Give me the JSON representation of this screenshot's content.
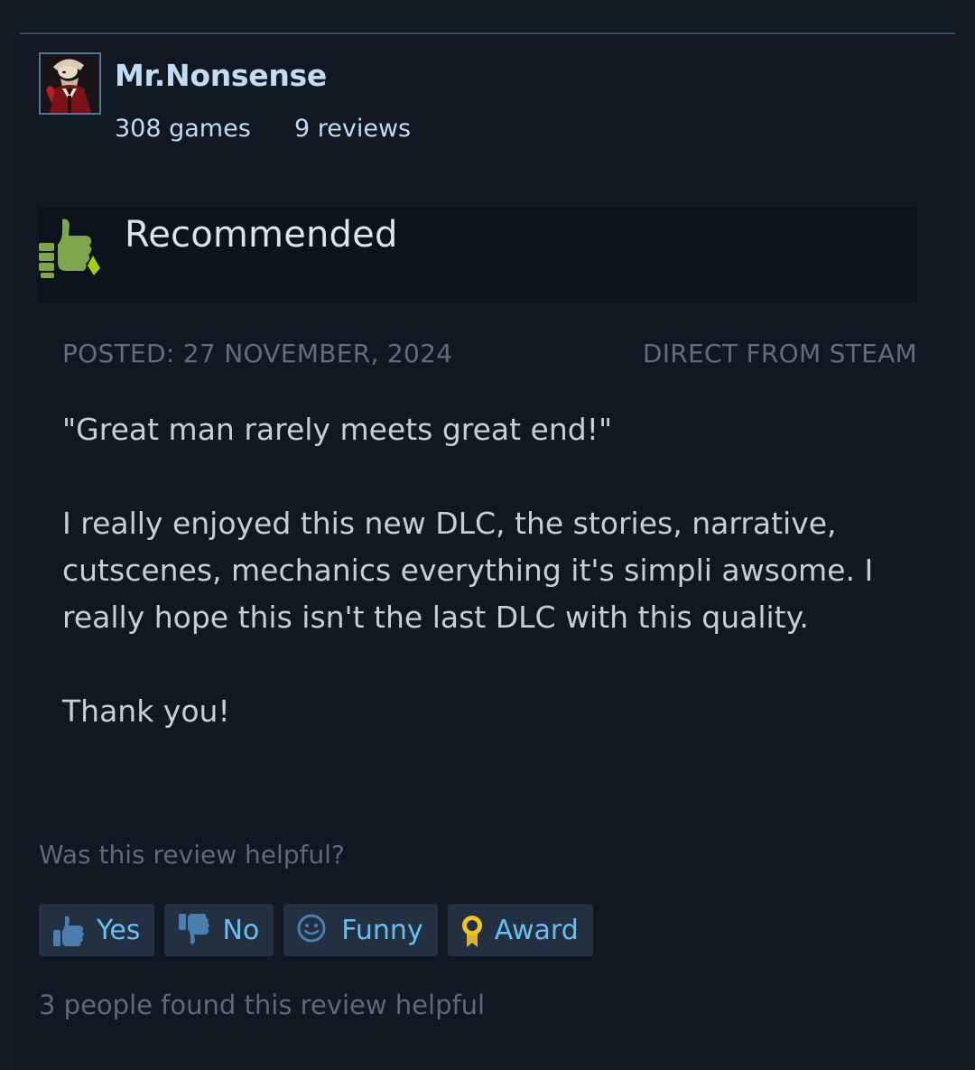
{
  "reviewer": {
    "name": "Mr.Nonsense",
    "games": "308 games",
    "reviews": "9 reviews"
  },
  "verdict": {
    "label": "Recommended",
    "icon": "thumbs-up-icon",
    "color": "#a4d007"
  },
  "meta": {
    "posted": "POSTED: 27 NOVEMBER, 2024",
    "source": "DIRECT FROM STEAM"
  },
  "review": {
    "paragraphs": [
      "\"Great man rarely meets great end!\"",
      "I really enjoyed this new DLC, the stories, narrative, cutscenes, mechanics everything it's simpli awsome. I really hope this isn't the last DLC with this quality.",
      "Thank you!"
    ]
  },
  "helpful": {
    "prompt": "Was this review helpful?",
    "buttons": [
      {
        "label": "Yes",
        "icon": "thumbs-up-icon"
      },
      {
        "label": "No",
        "icon": "thumbs-down-icon"
      },
      {
        "label": "Funny",
        "icon": "smiley-icon"
      },
      {
        "label": "Award",
        "icon": "award-icon"
      }
    ],
    "count_text": "3 people found this review helpful"
  },
  "colors": {
    "accent": "#66c0f4",
    "username": "#c1dbf4",
    "button_bg": "#223041",
    "recommended": "#a4d007"
  }
}
